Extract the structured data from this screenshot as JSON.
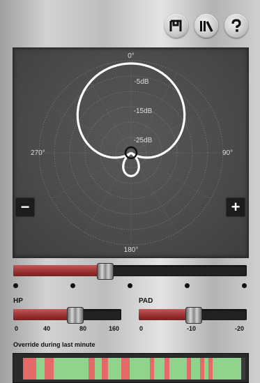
{
  "toolbar": {
    "buttons": [
      {
        "name": "save-button",
        "icon": "save-icon"
      },
      {
        "name": "library-button",
        "icon": "library-icon"
      },
      {
        "name": "help-button",
        "icon": "help-icon"
      }
    ]
  },
  "polar": {
    "angle_labels": [
      "0°",
      "90°",
      "180°",
      "270°"
    ],
    "ring_labels": [
      "-5dB",
      "-15dB",
      "-25dB"
    ],
    "pattern": "supercardioid",
    "minus_label": "−",
    "plus_label": "+"
  },
  "pattern_slider": {
    "value": 0.39,
    "positions": 5
  },
  "hp": {
    "label": "HP",
    "ticks": [
      "0",
      "40",
      "80",
      "160"
    ],
    "value": 0.57
  },
  "pad": {
    "label": "PAD",
    "ticks": [
      "0",
      "-10",
      "-20"
    ],
    "value": 0.5
  },
  "history": {
    "label": "Override during last minute",
    "colors": {
      "red": "#e46a6a",
      "green": "#8fd48a",
      "dark": "#3a3a3a"
    },
    "segments": [
      {
        "c": "red",
        "w": 0.06
      },
      {
        "c": "green",
        "w": 0.04
      },
      {
        "c": "red",
        "w": 0.04
      },
      {
        "c": "green",
        "w": 0.16
      },
      {
        "c": "red",
        "w": 0.03
      },
      {
        "c": "green",
        "w": 0.03
      },
      {
        "c": "red",
        "w": 0.03
      },
      {
        "c": "green",
        "w": 0.06
      },
      {
        "c": "red",
        "w": 0.04
      },
      {
        "c": "green",
        "w": 0.09
      },
      {
        "c": "red",
        "w": 0.02
      },
      {
        "c": "green",
        "w": 0.05
      },
      {
        "c": "red",
        "w": 0.02
      },
      {
        "c": "green",
        "w": 0.08
      },
      {
        "c": "red",
        "w": 0.02
      },
      {
        "c": "green",
        "w": 0.04
      },
      {
        "c": "red",
        "w": 0.02
      },
      {
        "c": "green",
        "w": 0.02
      },
      {
        "c": "red",
        "w": 0.02
      },
      {
        "c": "green",
        "w": 0.13
      },
      {
        "c": "dark",
        "w": 0.02
      }
    ]
  }
}
